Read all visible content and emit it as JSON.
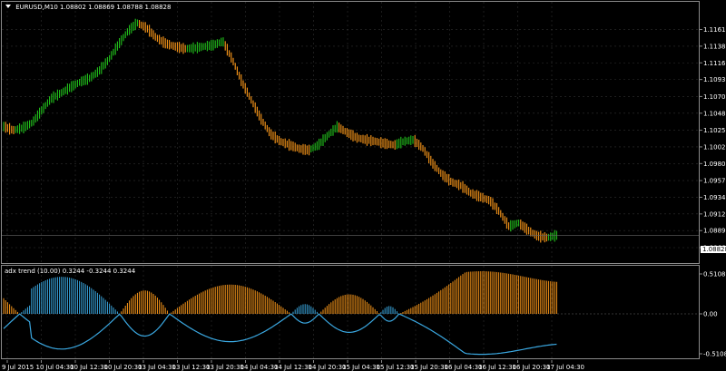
{
  "header": {
    "symbol_info": "EURUSD,M10  1.08802 1.08869 1.08788 1.08828",
    "dropdown_icon": "triangle-down-icon"
  },
  "price_axis": {
    "ticks": [
      "1.11610",
      "1.11385",
      "1.11160",
      "1.10935",
      "1.10705",
      "1.10480",
      "1.10250",
      "1.10025",
      "1.09800",
      "1.09570",
      "1.09345",
      "1.09120",
      "1.08895",
      "1.08665"
    ],
    "current_price": "1.08828"
  },
  "indicator": {
    "title": "adx trend (10.00) 0.3244 -0.3244 0.3244",
    "ticks": [
      "0.5108",
      "0.00",
      "-0.5108"
    ]
  },
  "time_axis": {
    "labels": [
      "9 Jul 2015",
      "10 Jul 04:30",
      "10 Jul 12:30",
      "10 Jul 20:30",
      "13 Jul 04:30",
      "13 Jul 12:30",
      "13 Jul 20:30",
      "14 Jul 04:30",
      "14 Jul 12:30",
      "14 Jul 20:30",
      "15 Jul 04:30",
      "15 Jul 12:30",
      "15 Jul 20:30",
      "16 Jul 04:30",
      "16 Jul 12:30",
      "16 Jul 20:30",
      "17 Jul 04:30"
    ]
  },
  "colors": {
    "bull": "#22c21c",
    "bear": "#ff9a1a",
    "adx_pos": "#3aa7e0",
    "adx_neg": "#ff9a1a",
    "grid": "#303030",
    "border": "#8a8a8a"
  },
  "chart_data": {
    "type": "line",
    "title": "",
    "series": [
      {
        "values": [
          1.103,
          1.1025,
          1.1028,
          1.1035,
          1.1052,
          1.1068,
          1.1075,
          1.1083,
          1.109,
          1.1095,
          1.1105,
          1.112,
          1.114,
          1.1158,
          1.117,
          1.1163,
          1.115,
          1.1142,
          1.1138,
          1.1135,
          1.1136,
          1.1138,
          1.114,
          1.1145,
          1.112,
          1.109,
          1.1065,
          1.104,
          1.102,
          1.101,
          1.1005,
          1.1,
          1.0998,
          1.1005,
          1.1018,
          1.103,
          1.1022,
          1.1015,
          1.1012,
          1.101,
          1.1007,
          1.1005,
          1.101,
          1.1012,
          1.1,
          1.098,
          1.0965,
          1.0955,
          1.095,
          1.094,
          1.0935,
          1.093,
          1.0915,
          1.0895,
          1.09,
          1.089,
          1.0882,
          1.088,
          1.0883
        ]
      }
    ],
    "ylim": [
      1.08665,
      1.118
    ]
  }
}
